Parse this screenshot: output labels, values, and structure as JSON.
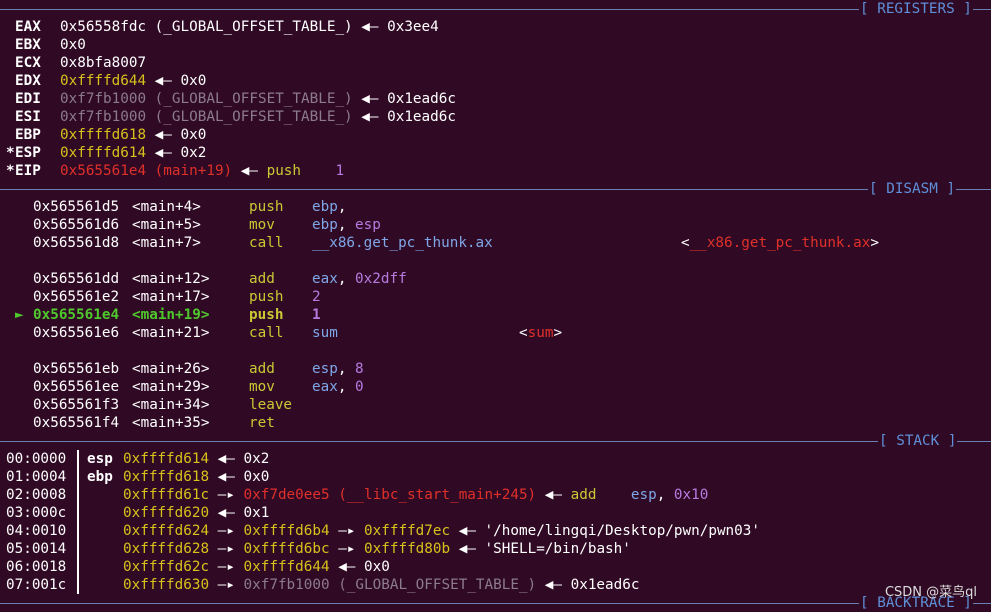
{
  "headers": {
    "registers": "[ REGISTERS ]",
    "disasm": "[ DISASM ]",
    "stack": "[ STACK ]",
    "backtrace": "[ BACKTRACE ]"
  },
  "registers": [
    {
      "mark": " ",
      "name": "EAX",
      "val": "0x56558fdc",
      "sym": " (_GLOBAL_OFFSET_TABLE_)",
      "arrow": " ◀— ",
      "tail": "0x3ee4"
    },
    {
      "mark": " ",
      "name": "EBX",
      "val": "0x0"
    },
    {
      "mark": " ",
      "name": "ECX",
      "val": "0x8bfa8007"
    },
    {
      "mark": " ",
      "name": "EDX",
      "val": "0xffffd644",
      "arrow": " ◀— ",
      "tail": "0x0"
    },
    {
      "mark": " ",
      "name": "EDI",
      "val": "0xf7fb1000",
      "sym": " (_GLOBAL_OFFSET_TABLE_)",
      "arrow": " ◀— ",
      "tail": "0x1ead6c"
    },
    {
      "mark": " ",
      "name": "ESI",
      "val": "0xf7fb1000",
      "sym": " (_GLOBAL_OFFSET_TABLE_)",
      "arrow": " ◀— ",
      "tail": "0x1ead6c"
    },
    {
      "mark": " ",
      "name": "EBP",
      "val": "0xffffd618",
      "arrow": " ◀— ",
      "tail": "0x0"
    },
    {
      "mark": "*",
      "name": "ESP",
      "val": "0xffffd614",
      "arrow": " ◀— ",
      "tail": "0x2"
    },
    {
      "mark": "*",
      "name": "EIP",
      "val": "0x565561e4",
      "sym": " (main+19)",
      "arrow": " ◀— ",
      "op": "push",
      "arg": "1"
    }
  ],
  "disasm": [
    {
      "addr": "0x565561d5",
      "loc": "<main+4>",
      "mn": "push",
      "ops": "ebp"
    },
    {
      "addr": "0x565561d6",
      "loc": "<main+5>",
      "mn": "mov",
      "ops": "ebp, esp"
    },
    {
      "addr": "0x565561d8",
      "loc": "<main+7>",
      "mn": "call",
      "ops": "__x86.get_pc_thunk.ax",
      "target": "__x86.get_pc_thunk.ax"
    },
    {
      "addr": "0x565561dd",
      "loc": "<main+12>",
      "mn": "add",
      "ops": "eax, 0x2dff"
    },
    {
      "addr": "0x565561e2",
      "loc": "<main+17>",
      "mn": "push",
      "ops": "2"
    },
    {
      "addr": "0x565561e4",
      "loc": "<main+19>",
      "mn": "push",
      "ops": "1",
      "current": true,
      "marker": "►"
    },
    {
      "addr": "0x565561e6",
      "loc": "<main+21>",
      "mn": "call",
      "ops": "sum",
      "target": "sum"
    },
    {
      "addr": "0x565561eb",
      "loc": "<main+26>",
      "mn": "add",
      "ops": "esp, 8"
    },
    {
      "addr": "0x565561ee",
      "loc": "<main+29>",
      "mn": "mov",
      "ops": "eax, 0"
    },
    {
      "addr": "0x565561f3",
      "loc": "<main+34>",
      "mn": "leave",
      "ops": ""
    },
    {
      "addr": "0x565561f4",
      "loc": "<main+35>",
      "mn": "ret",
      "ops": ""
    }
  ],
  "stack": [
    {
      "idx": "00:0000",
      "reg": "esp",
      "addr": "0xffffd614",
      "chain": [
        {
          "t": " ◀— ",
          "c": "w"
        },
        {
          "t": "0x2",
          "c": "w"
        }
      ]
    },
    {
      "idx": "01:0004",
      "reg": "ebp",
      "addr": "0xffffd618",
      "chain": [
        {
          "t": " ◀— ",
          "c": "w"
        },
        {
          "t": "0x0",
          "c": "w"
        }
      ]
    },
    {
      "idx": "02:0008",
      "reg": "",
      "addr": "0xffffd61c",
      "chain": [
        {
          "t": " —▸ ",
          "c": "w"
        },
        {
          "t": "0xf7de0ee5 (__libc_start_main+245)",
          "c": "red"
        },
        {
          "t": " ◀— ",
          "c": "w"
        },
        {
          "t": "add",
          "c": "olive"
        },
        {
          "t": "    ",
          "c": "w"
        },
        {
          "t": "esp",
          "c": "blue"
        },
        {
          "t": ", ",
          "c": "w"
        },
        {
          "t": "0x10",
          "c": "purp"
        }
      ]
    },
    {
      "idx": "03:000c",
      "reg": "",
      "addr": "0xffffd620",
      "chain": [
        {
          "t": " ◀— ",
          "c": "w"
        },
        {
          "t": "0x1",
          "c": "w"
        }
      ]
    },
    {
      "idx": "04:0010",
      "reg": "",
      "addr": "0xffffd624",
      "chain": [
        {
          "t": " —▸ ",
          "c": "w"
        },
        {
          "t": "0xffffd6b4",
          "c": "yel"
        },
        {
          "t": " —▸ ",
          "c": "w"
        },
        {
          "t": "0xffffd7ec",
          "c": "yel"
        },
        {
          "t": " ◀— ",
          "c": "w"
        },
        {
          "t": "'/home/lingqi/Desktop/pwn/pwn03'",
          "c": "w"
        }
      ]
    },
    {
      "idx": "05:0014",
      "reg": "",
      "addr": "0xffffd628",
      "chain": [
        {
          "t": " —▸ ",
          "c": "w"
        },
        {
          "t": "0xffffd6bc",
          "c": "yel"
        },
        {
          "t": " —▸ ",
          "c": "w"
        },
        {
          "t": "0xffffd80b",
          "c": "yel"
        },
        {
          "t": " ◀— ",
          "c": "w"
        },
        {
          "t": "'SHELL=/bin/bash'",
          "c": "w"
        }
      ]
    },
    {
      "idx": "06:0018",
      "reg": "",
      "addr": "0xffffd62c",
      "chain": [
        {
          "t": " —▸ ",
          "c": "w"
        },
        {
          "t": "0xffffd644",
          "c": "yel"
        },
        {
          "t": " ◀— ",
          "c": "w"
        },
        {
          "t": "0x0",
          "c": "w"
        }
      ]
    },
    {
      "idx": "07:001c",
      "reg": "",
      "addr": "0xffffd630",
      "chain": [
        {
          "t": " —▸ ",
          "c": "w"
        },
        {
          "t": "0xf7fb1000 (_GLOBAL_OFFSET_TABLE_)",
          "c": "grey"
        },
        {
          "t": " ◀— ",
          "c": "w"
        },
        {
          "t": "0x1ead6c",
          "c": "w"
        }
      ]
    }
  ],
  "watermark": "CSDN @菜鸟ql"
}
